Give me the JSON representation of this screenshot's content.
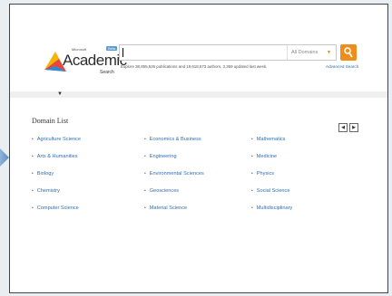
{
  "logo": {
    "microsoft": "Microsoft",
    "beta": "Beta",
    "name": "Academic",
    "search": "Search"
  },
  "search": {
    "value": "",
    "domain": "All Domains",
    "explore_text": "Explore 38,855,526 publications and 19,618,573 authors, 3,369 updated last week.",
    "advanced": "Advanced Search"
  },
  "domains": {
    "title": "Domain List",
    "columns": [
      [
        "Agriculture Science",
        "Arts & Humanities",
        "Biology",
        "Chemistry",
        "Computer Science"
      ],
      [
        "Economics & Business",
        "Engineering",
        "Environmental Sciences",
        "Geosciences",
        "Material Science"
      ],
      [
        "Mathematics",
        "Medicine",
        "Physics",
        "Social Science",
        "Multidisciplinary"
      ]
    ]
  },
  "colors": {
    "link": "#2e6db4",
    "search_button": "#f08c1a"
  },
  "icons": [
    "search-icon",
    "previous-page-icon",
    "next-page-icon",
    "dropdown-arrow-icon"
  ]
}
